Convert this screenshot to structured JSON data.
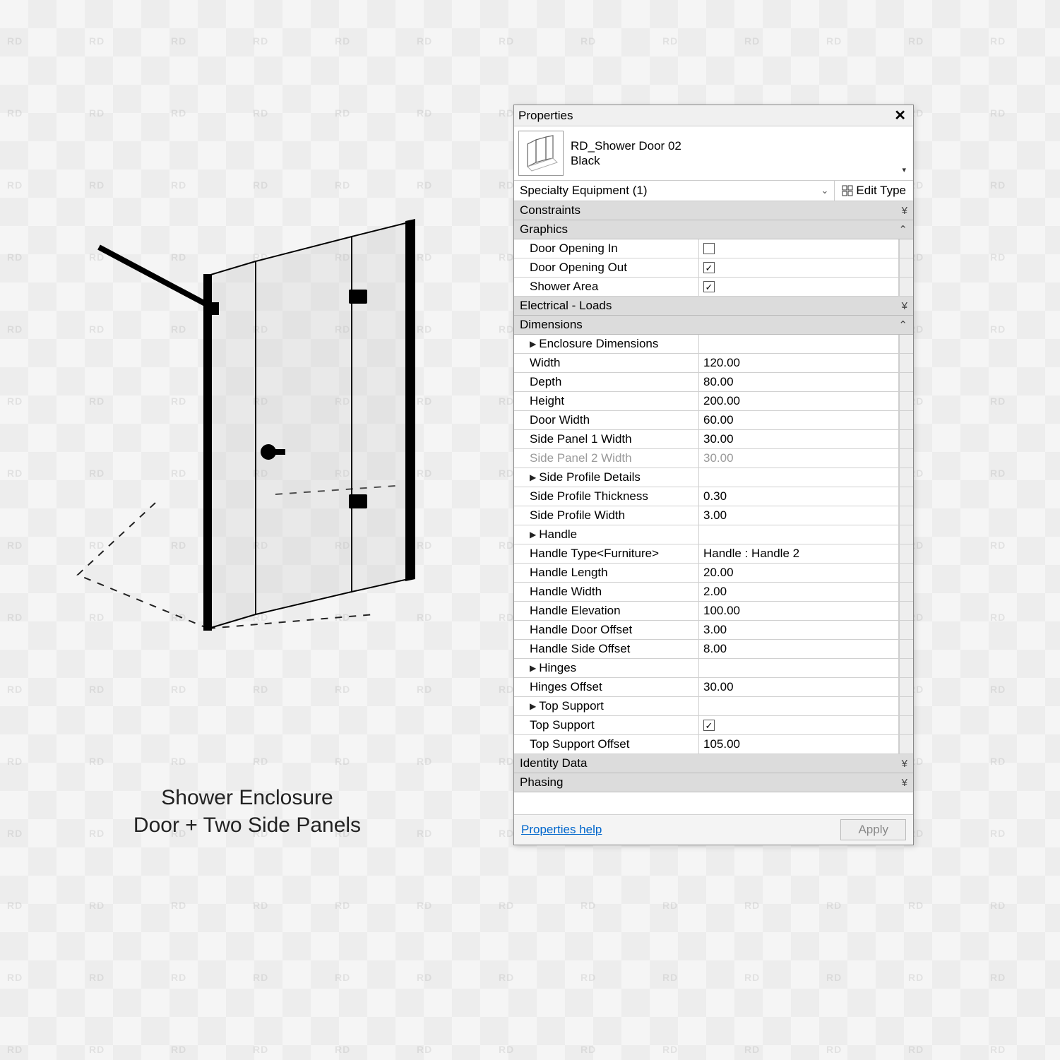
{
  "caption": {
    "line1": "Shower Enclosure",
    "line2": "Door + Two Side Panels"
  },
  "panel": {
    "title": "Properties",
    "family_name": "RD_Shower Door 02",
    "family_type": "Black",
    "selector": "Specialty Equipment (1)",
    "edit_type": "Edit Type",
    "footer_help": "Properties help",
    "apply": "Apply",
    "groups": {
      "constraints": "Constraints",
      "graphics": "Graphics",
      "electrical": "Electrical - Loads",
      "dimensions": "Dimensions",
      "identity": "Identity Data",
      "phasing": "Phasing"
    },
    "graphics_rows": {
      "door_in": {
        "label": "Door Opening In",
        "checked": false
      },
      "door_out": {
        "label": "Door Opening Out",
        "checked": true
      },
      "shower_area": {
        "label": "Shower Area",
        "checked": true
      }
    },
    "dim": {
      "enclosure": "Enclosure Dimensions",
      "width": {
        "label": "Width",
        "value": "120.00"
      },
      "depth": {
        "label": "Depth",
        "value": "80.00"
      },
      "height": {
        "label": "Height",
        "value": "200.00"
      },
      "door_width": {
        "label": "Door Width",
        "value": "60.00"
      },
      "side1": {
        "label": "Side Panel 1 Width",
        "value": "30.00"
      },
      "side2": {
        "label": "Side Panel 2 Width",
        "value": "30.00"
      },
      "side_profile": "Side Profile Details",
      "sp_thick": {
        "label": "Side Profile Thickness",
        "value": "0.30"
      },
      "sp_width": {
        "label": "Side Profile Width",
        "value": "3.00"
      },
      "handle_hdr": "Handle",
      "handle_type": {
        "label": "Handle Type<Furniture>",
        "value": "Handle : Handle 2"
      },
      "handle_len": {
        "label": "Handle Length",
        "value": "20.00"
      },
      "handle_w": {
        "label": "Handle Width",
        "value": "2.00"
      },
      "handle_elev": {
        "label": "Handle Elevation",
        "value": "100.00"
      },
      "handle_do": {
        "label": "Handle Door Offset",
        "value": "3.00"
      },
      "handle_so": {
        "label": "Handle Side Offset",
        "value": "8.00"
      },
      "hinges_hdr": "Hinges",
      "hinges_off": {
        "label": "Hinges Offset",
        "value": "30.00"
      },
      "top_hdr": "Top Support",
      "top_chk": {
        "label": "Top Support",
        "checked": true
      },
      "top_off": {
        "label": "Top Support Offset",
        "value": "105.00"
      }
    }
  }
}
